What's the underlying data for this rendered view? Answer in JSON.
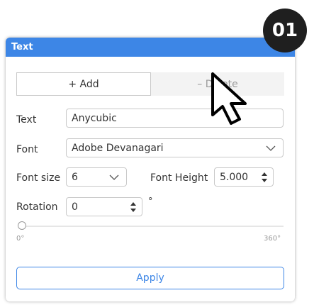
{
  "step_badge": "01",
  "panel": {
    "title": "Text",
    "add_label": "+ Add",
    "delete_label": "– Delete",
    "text_label": "Text",
    "text_value": "Anycubic",
    "font_label": "Font",
    "font_value": "Adobe Devanagari",
    "font_size_label": "Font size",
    "font_size_value": "6",
    "font_height_label": "Font Height",
    "font_height_value": "5.000",
    "rotation_label": "Rotation",
    "rotation_value": "0",
    "rotation_unit": "°",
    "slider_min_label": "0°",
    "slider_max_label": "360°",
    "slider_value_fraction": 0,
    "apply_label": "Apply"
  },
  "colors": {
    "accent": "#3d86e6",
    "badge": "#1f1f1f"
  },
  "icons": {
    "cursor": "mouse-pointer-icon",
    "dropdown": "chevron-down-icon",
    "spinner": "spinner-arrows-icon"
  }
}
